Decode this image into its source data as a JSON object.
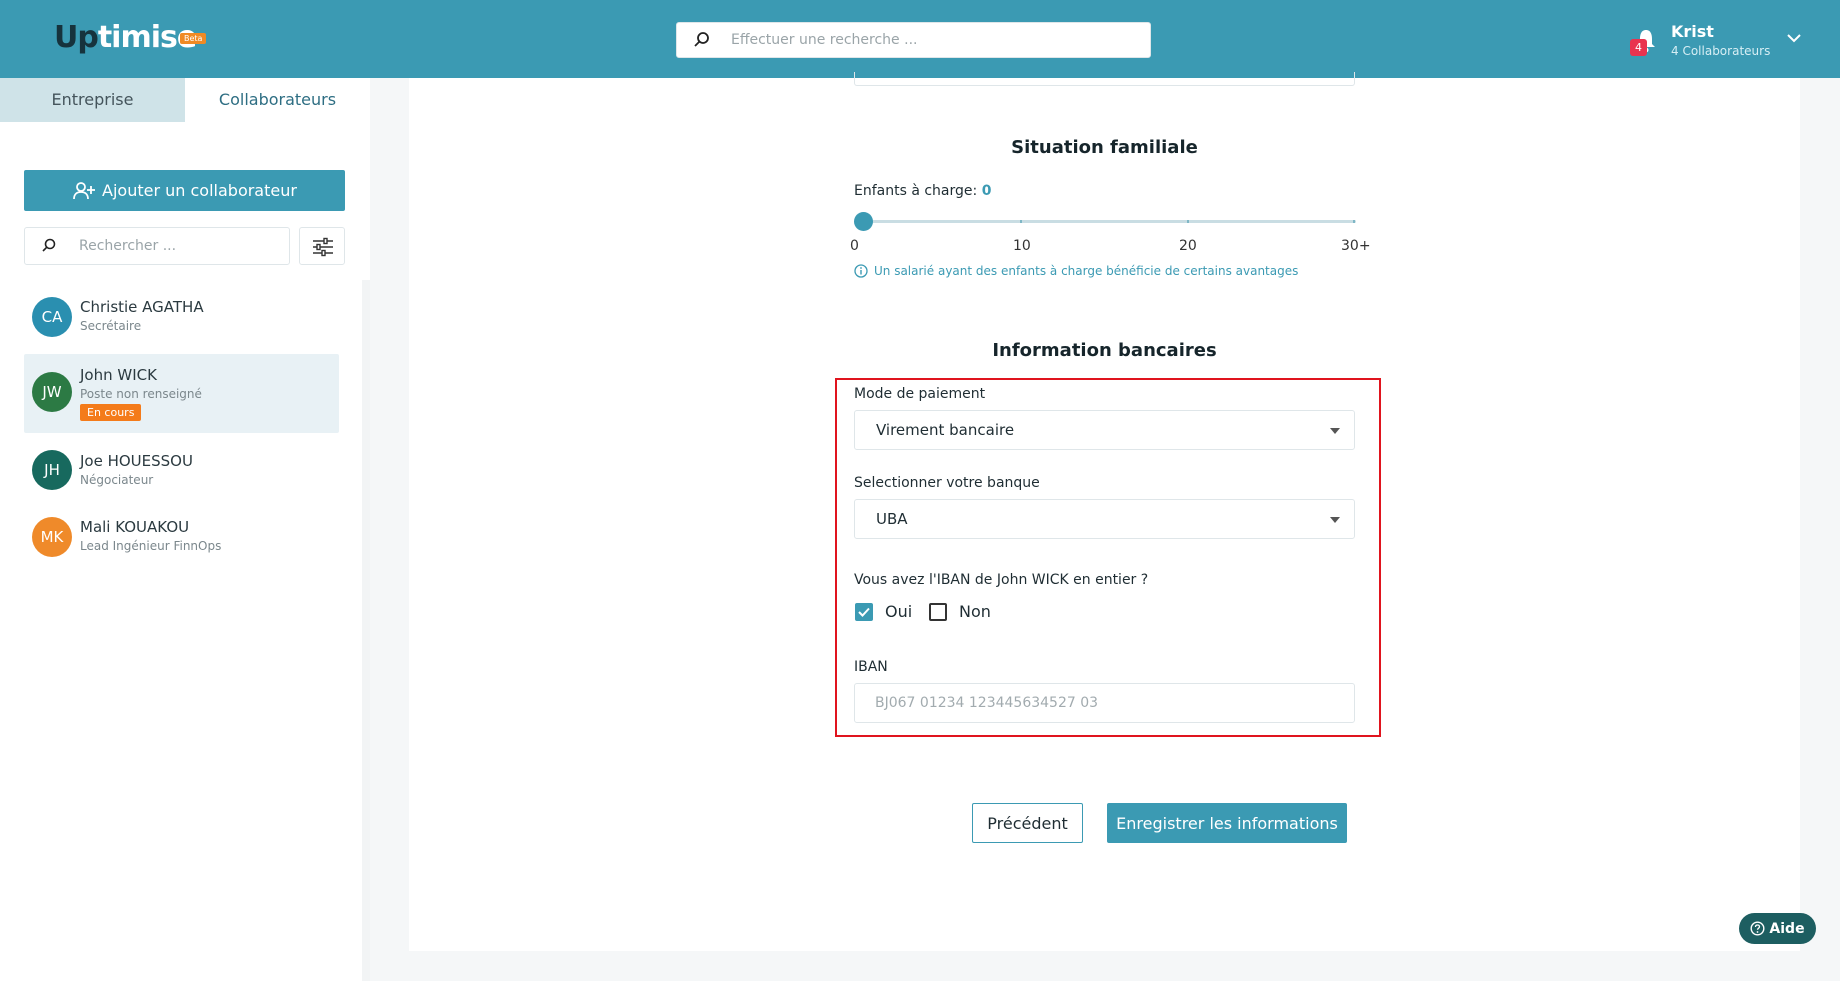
{
  "header": {
    "logo_up": "Up",
    "logo_rest": "timise",
    "beta": "Beta",
    "search_placeholder": "Effectuer une recherche ...",
    "notifications_count": "4",
    "user_name": "Krist",
    "user_sub": "4 Collaborateurs"
  },
  "sidebar": {
    "tabs": [
      {
        "label": "Entreprise"
      },
      {
        "label": "Collaborateurs"
      }
    ],
    "add_button": "Ajouter un collaborateur",
    "search_placeholder": "Rechercher ...",
    "collaborators": [
      {
        "initials": "CA",
        "name": "Christie AGATHA",
        "role": "Secrétaire",
        "color": "#2a8fb0"
      },
      {
        "initials": "JW",
        "name": "John WICK",
        "role": "Poste non renseigné",
        "status": "En cours",
        "color": "#2c7a44"
      },
      {
        "initials": "JH",
        "name": "Joe HOUESSOU",
        "role": "Négociateur",
        "color": "#17695e"
      },
      {
        "initials": "MK",
        "name": "Mali KOUAKOU",
        "role": "Lead Ingénieur FinnOps",
        "color": "#ef8a2a"
      }
    ]
  },
  "main": {
    "situation_title": "Situation familiale",
    "enfants_label": "Enfants à charge:",
    "enfants_value": "0",
    "slider": {
      "value": 0,
      "min": 0,
      "max": 30,
      "ticks": [
        "0",
        "10",
        "20",
        "30+"
      ]
    },
    "hint": "Un salarié ayant des enfants à charge bénéficie de certains avantages",
    "bank_title": "Information bancaires",
    "payment_label": "Mode de paiement",
    "payment_value": "Virement bancaire",
    "bank_label": "Selectionner votre banque",
    "bank_value": "UBA",
    "iban_question": "Vous avez l'IBAN de John WICK en entier ?",
    "oui_label": "Oui",
    "non_label": "Non",
    "oui_checked": true,
    "non_checked": false,
    "iban_label": "IBAN",
    "iban_placeholder": "BJ067 01234 123445634527 03",
    "prev_button": "Précédent",
    "save_button": "Enregistrer les informations"
  },
  "help_button": "Aide",
  "colors": {
    "accent": "#3b9ab3",
    "status": "#f47b1a",
    "highlight": "#e0141e"
  }
}
